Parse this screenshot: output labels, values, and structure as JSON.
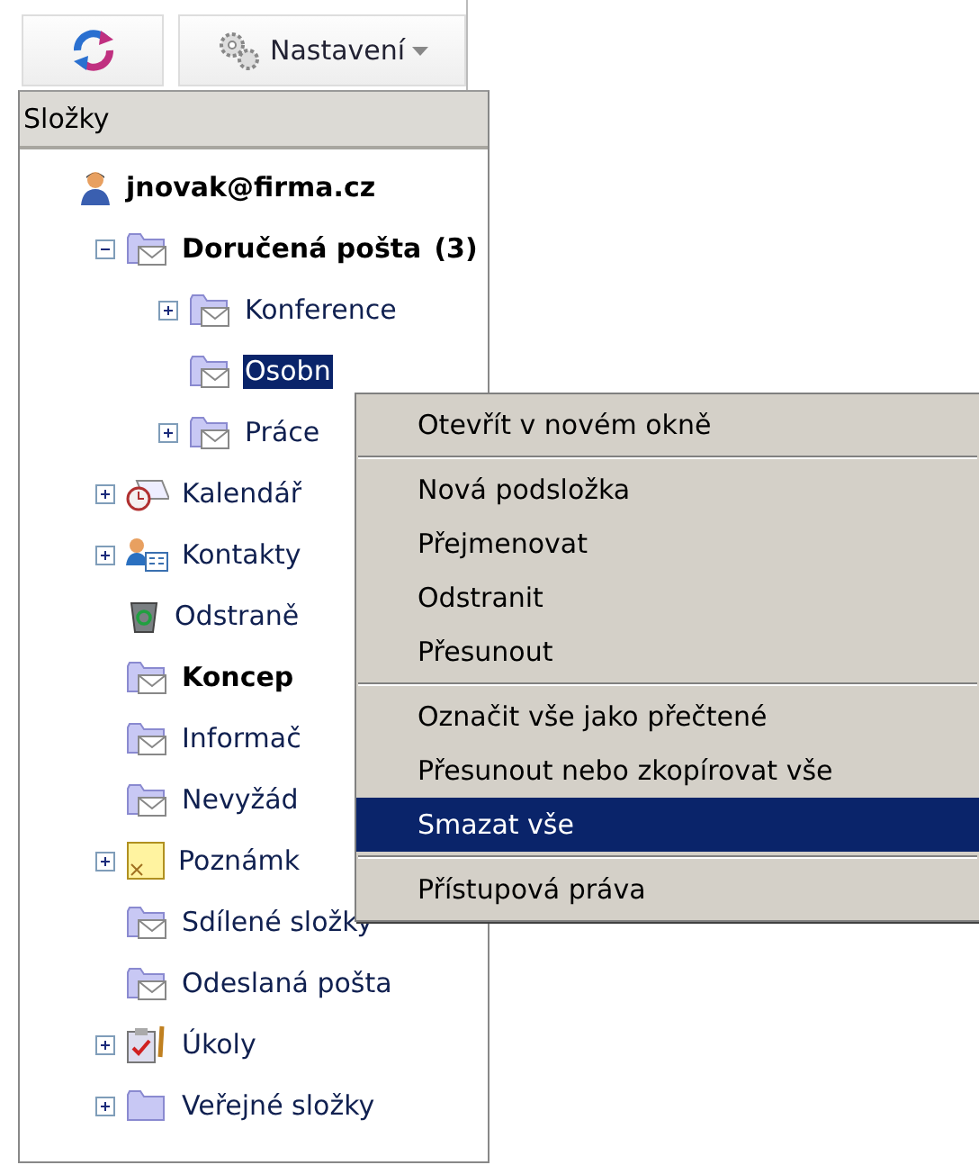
{
  "toolbar": {
    "buttons": [
      {
        "kind": "refresh"
      },
      {
        "kind": "settings",
        "label": "Nastavení",
        "dropdown": true
      }
    ]
  },
  "panel": {
    "title": "Složky"
  },
  "tree": {
    "label": "jnovak@firma.cz",
    "kind": "user",
    "bold": true,
    "selected": false,
    "children": [
      {
        "label": "Doručená pošta",
        "count": "(3)",
        "kind": "mail-folder",
        "bold": true,
        "selected": false,
        "expanded": true,
        "children": [
          {
            "label": "Konference",
            "kind": "mail-folder",
            "bold": false,
            "selected": false,
            "expanded": false
          },
          {
            "label": "Osobn",
            "kind": "mail-folder",
            "bold": false,
            "selected": true
          },
          {
            "label": "Práce",
            "kind": "mail-folder",
            "bold": false,
            "selected": false,
            "expanded": false
          }
        ]
      },
      {
        "label": "Kalendář",
        "kind": "calendar",
        "bold": false,
        "selected": false,
        "expanded": false
      },
      {
        "label": "Kontakty",
        "kind": "contacts",
        "bold": false,
        "selected": false,
        "expanded": false
      },
      {
        "label": "Odstraně",
        "kind": "trash",
        "bold": false,
        "selected": false
      },
      {
        "label": "Koncep",
        "kind": "mail-folder",
        "bold": true,
        "selected": false
      },
      {
        "label": "Informač",
        "kind": "mail-folder",
        "bold": false,
        "selected": false
      },
      {
        "label": "Nevyžád",
        "kind": "mail-folder",
        "bold": false,
        "selected": false
      },
      {
        "label": "Poznámk",
        "kind": "note",
        "bold": false,
        "selected": false,
        "expanded": false
      },
      {
        "label": "Sdílené složky",
        "kind": "mail-folder",
        "bold": false,
        "selected": false
      },
      {
        "label": "Odeslaná pošta",
        "kind": "mail-folder",
        "bold": false,
        "selected": false
      },
      {
        "label": "Úkoly",
        "kind": "tasks",
        "bold": false,
        "selected": false,
        "expanded": false
      },
      {
        "label": "Veřejné složky",
        "kind": "folder",
        "bold": false,
        "selected": false,
        "expanded": false
      }
    ]
  },
  "context_menu": {
    "groups": [
      [
        {
          "label": "Otevřít v novém okně",
          "selected": false
        }
      ],
      [
        {
          "label": "Nová podsložka",
          "selected": false
        },
        {
          "label": "Přejmenovat",
          "selected": false
        },
        {
          "label": "Odstranit",
          "selected": false
        },
        {
          "label": "Přesunout",
          "selected": false
        }
      ],
      [
        {
          "label": "Označit vše jako přečtené",
          "selected": false
        },
        {
          "label": "Přesunout nebo zkopírovat vše",
          "selected": false
        },
        {
          "label": "Smazat vše",
          "selected": true
        }
      ],
      [
        {
          "label": "Přístupová práva",
          "selected": false
        }
      ]
    ]
  }
}
